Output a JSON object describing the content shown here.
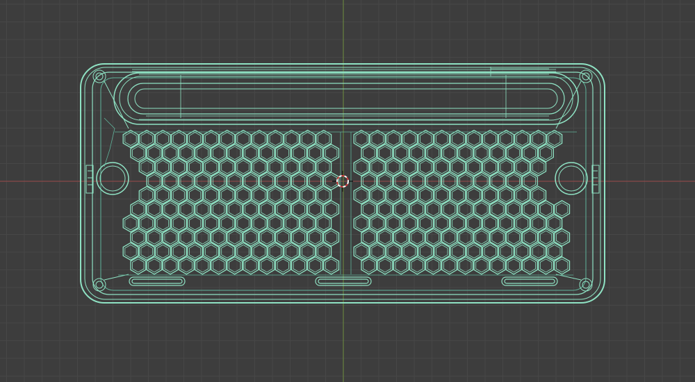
{
  "viewport": {
    "background": "#3d3d3d",
    "grid_minor_color": "#474747",
    "grid_major_color": "#4a4a4a",
    "x_axis_color": "#9a4a4a",
    "y_axis_color": "#6f8f3f"
  },
  "model": {
    "wire_color": "#8fe3c4",
    "wire_dim_color": "#5fb39a",
    "mounting_holes": 2,
    "bottom_feet": 3,
    "hex_panels": 2
  },
  "cursor": {
    "icon": "3d-cursor-icon",
    "ring_color_a": "#ffffff",
    "ring_color_b": "#d04040"
  }
}
